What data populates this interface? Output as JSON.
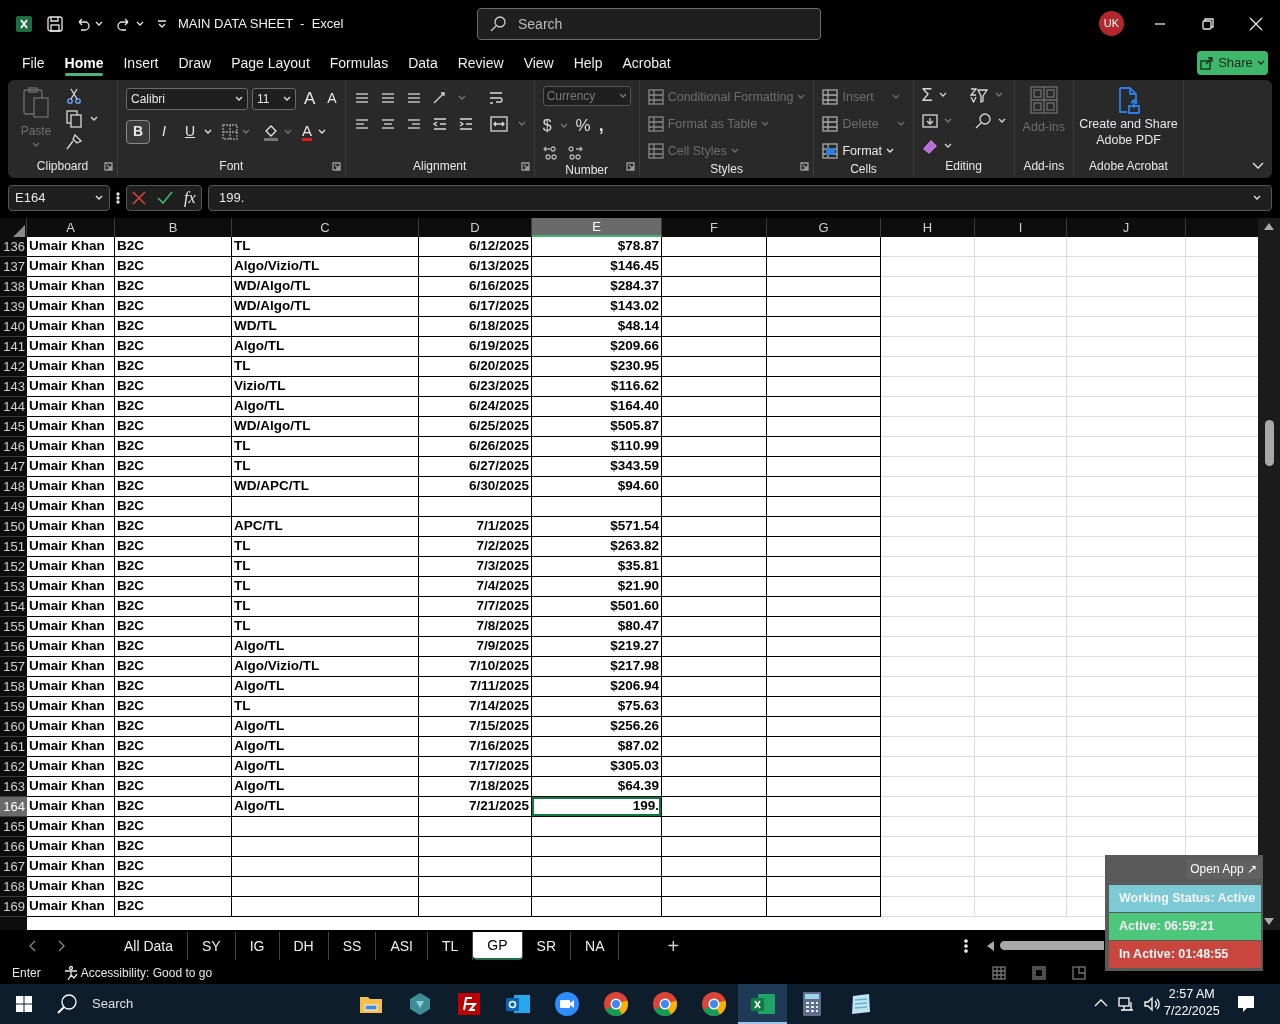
{
  "window": {
    "title": "MAIN DATA SHEET  -  Excel",
    "search_placeholder": "Search",
    "avatar": "UK"
  },
  "menu": [
    {
      "label": "File",
      "selected": false
    },
    {
      "label": "Home",
      "selected": true
    },
    {
      "label": "Insert",
      "selected": false
    },
    {
      "label": "Draw",
      "selected": false
    },
    {
      "label": "Page Layout",
      "selected": false
    },
    {
      "label": "Formulas",
      "selected": false
    },
    {
      "label": "Data",
      "selected": false
    },
    {
      "label": "Review",
      "selected": false
    },
    {
      "label": "View",
      "selected": false
    },
    {
      "label": "Help",
      "selected": false
    },
    {
      "label": "Acrobat",
      "selected": false
    }
  ],
  "share_button": "Share",
  "ribbon": {
    "clipboard": {
      "label": "Clipboard",
      "paste": "Paste",
      "paste_disabled": true
    },
    "font": {
      "label": "Font",
      "family": "Calibri",
      "size": "11",
      "grow": "A",
      "shrink": "A",
      "color_button": "A",
      "styles": [
        {
          "label": "B",
          "selected": true
        },
        {
          "label": "I",
          "selected": false
        },
        {
          "label": "U",
          "selected": false
        }
      ]
    },
    "alignment": {
      "label": "Alignment"
    },
    "number": {
      "label": "Number",
      "format": "Currency",
      "currency": "$",
      "percent": "%",
      "comma": ","
    },
    "styles": {
      "label": "Styles",
      "items": [
        {
          "label": "Conditional Formatting",
          "disabled": true
        },
        {
          "label": "Format as Table",
          "disabled": true
        },
        {
          "label": "Cell Styles",
          "disabled": true
        }
      ]
    },
    "cells": {
      "label": "Cells",
      "items": [
        {
          "label": "Insert",
          "disabled": true
        },
        {
          "label": "Delete",
          "disabled": true
        },
        {
          "label": "Format",
          "disabled": false
        }
      ]
    },
    "editing": {
      "label": "Editing",
      "sum": "Σ"
    },
    "addins": {
      "label": "Add-ins",
      "button": "Add-ins",
      "disabled": true
    },
    "acrobat": {
      "label": "Adobe Acrobat",
      "button": "Create and Share Adobe PDF"
    }
  },
  "formula_bar": {
    "name_box": "E164",
    "fx": "fx",
    "value": "199."
  },
  "columns": [
    {
      "label": "A",
      "selected": false
    },
    {
      "label": "B",
      "selected": false
    },
    {
      "label": "C",
      "selected": false
    },
    {
      "label": "D",
      "selected": false
    },
    {
      "label": "E",
      "selected": true
    },
    {
      "label": "F",
      "selected": false
    },
    {
      "label": "G",
      "selected": false
    },
    {
      "label": "H",
      "selected": false
    },
    {
      "label": "I",
      "selected": false
    },
    {
      "label": "J",
      "selected": false
    }
  ],
  "rows": [
    {
      "row": "136",
      "selected": false,
      "a": "Umair Khan",
      "b": "B2C",
      "c": "TL",
      "d": "6/12/2025",
      "e": "$78.87"
    },
    {
      "row": "137",
      "selected": false,
      "a": "Umair Khan",
      "b": "B2C",
      "c": "Algo/Vizio/TL",
      "d": "6/13/2025",
      "e": "$146.45"
    },
    {
      "row": "138",
      "selected": false,
      "a": "Umair Khan",
      "b": "B2C",
      "c": "WD/Algo/TL",
      "d": "6/16/2025",
      "e": "$284.37"
    },
    {
      "row": "139",
      "selected": false,
      "a": "Umair Khan",
      "b": "B2C",
      "c": "WD/Algo/TL",
      "d": "6/17/2025",
      "e": "$143.02"
    },
    {
      "row": "140",
      "selected": false,
      "a": "Umair Khan",
      "b": "B2C",
      "c": "WD/TL",
      "d": "6/18/2025",
      "e": "$48.14"
    },
    {
      "row": "141",
      "selected": false,
      "a": "Umair Khan",
      "b": "B2C",
      "c": "Algo/TL",
      "d": "6/19/2025",
      "e": "$209.66"
    },
    {
      "row": "142",
      "selected": false,
      "a": "Umair Khan",
      "b": "B2C",
      "c": "TL",
      "d": "6/20/2025",
      "e": "$230.95"
    },
    {
      "row": "143",
      "selected": false,
      "a": "Umair Khan",
      "b": "B2C",
      "c": "Vizio/TL",
      "d": "6/23/2025",
      "e": "$116.62"
    },
    {
      "row": "144",
      "selected": false,
      "a": "Umair Khan",
      "b": "B2C",
      "c": "Algo/TL",
      "d": "6/24/2025",
      "e": "$164.40"
    },
    {
      "row": "145",
      "selected": false,
      "a": "Umair Khan",
      "b": "B2C",
      "c": "WD/Algo/TL",
      "d": "6/25/2025",
      "e": "$505.87"
    },
    {
      "row": "146",
      "selected": false,
      "a": "Umair Khan",
      "b": "B2C",
      "c": "TL",
      "d": "6/26/2025",
      "e": "$110.99"
    },
    {
      "row": "147",
      "selected": false,
      "a": "Umair Khan",
      "b": "B2C",
      "c": "TL",
      "d": "6/27/2025",
      "e": "$343.59"
    },
    {
      "row": "148",
      "selected": false,
      "a": "Umair Khan",
      "b": "B2C",
      "c": "WD/APC/TL",
      "d": "6/30/2025",
      "e": "$94.60"
    },
    {
      "row": "149",
      "selected": false,
      "a": "Umair Khan",
      "b": "B2C"
    },
    {
      "row": "150",
      "selected": false,
      "a": "Umair Khan",
      "b": "B2C",
      "c": "APC/TL",
      "d": "7/1/2025",
      "e": "$571.54"
    },
    {
      "row": "151",
      "selected": false,
      "a": "Umair Khan",
      "b": "B2C",
      "c": "TL",
      "d": "7/2/2025",
      "e": "$263.82"
    },
    {
      "row": "152",
      "selected": false,
      "a": "Umair Khan",
      "b": "B2C",
      "c": "TL",
      "d": "7/3/2025",
      "e": "$35.81"
    },
    {
      "row": "153",
      "selected": false,
      "a": "Umair Khan",
      "b": "B2C",
      "c": "TL",
      "d": "7/4/2025",
      "e": "$21.90"
    },
    {
      "row": "154",
      "selected": false,
      "a": "Umair Khan",
      "b": "B2C",
      "c": "TL",
      "d": "7/7/2025",
      "e": "$501.60"
    },
    {
      "row": "155",
      "selected": false,
      "a": "Umair Khan",
      "b": "B2C",
      "c": "TL",
      "d": "7/8/2025",
      "e": "$80.47"
    },
    {
      "row": "156",
      "selected": false,
      "a": "Umair Khan",
      "b": "B2C",
      "c": "Algo/TL",
      "d": "7/9/2025",
      "e": "$219.27"
    },
    {
      "row": "157",
      "selected": false,
      "a": "Umair Khan",
      "b": "B2C",
      "c": "Algo/Vizio/TL",
      "d": "7/10/2025",
      "e": "$217.98"
    },
    {
      "row": "158",
      "selected": false,
      "a": "Umair Khan",
      "b": "B2C",
      "c": "Algo/TL",
      "d": "7/11/2025",
      "e": "$206.94"
    },
    {
      "row": "159",
      "selected": false,
      "a": "Umair Khan",
      "b": "B2C",
      "c": "TL",
      "d": "7/14/2025",
      "e": "$75.63"
    },
    {
      "row": "160",
      "selected": false,
      "a": "Umair Khan",
      "b": "B2C",
      "c": "Algo/TL",
      "d": "7/15/2025",
      "e": "$256.26"
    },
    {
      "row": "161",
      "selected": false,
      "a": "Umair Khan",
      "b": "B2C",
      "c": "Algo/TL",
      "d": "7/16/2025",
      "e": "$87.02"
    },
    {
      "row": "162",
      "selected": false,
      "a": "Umair Khan",
      "b": "B2C",
      "c": "Algo/TL",
      "d": "7/17/2025",
      "e": "$305.03"
    },
    {
      "row": "163",
      "selected": false,
      "a": "Umair Khan",
      "b": "B2C",
      "c": "Algo/TL",
      "d": "7/18/2025",
      "e": "$64.39"
    },
    {
      "row": "164",
      "selected": true,
      "a": "Umair Khan",
      "b": "B2C",
      "c": "Algo/TL",
      "d": "7/21/2025",
      "e": "199."
    },
    {
      "row": "165",
      "selected": false,
      "a": "Umair Khan",
      "b": "B2C"
    },
    {
      "row": "166",
      "selected": false,
      "a": "Umair Khan",
      "b": "B2C"
    },
    {
      "row": "167",
      "selected": false,
      "a": "Umair Khan",
      "b": "B2C"
    },
    {
      "row": "168",
      "selected": false,
      "a": "Umair Khan",
      "b": "B2C"
    },
    {
      "row": "169",
      "selected": false,
      "a": "Umair Khan",
      "b": "B2C"
    }
  ],
  "sheet_tabs": [
    {
      "label": "All Data",
      "selected": false
    },
    {
      "label": "SY",
      "selected": false
    },
    {
      "label": "IG",
      "selected": false
    },
    {
      "label": "DH",
      "selected": false
    },
    {
      "label": "SS",
      "selected": false
    },
    {
      "label": "ASI",
      "selected": false
    },
    {
      "label": "TL",
      "selected": false
    },
    {
      "label": "GP",
      "selected": true
    },
    {
      "label": "SR",
      "selected": false
    },
    {
      "label": "NA",
      "selected": false
    }
  ],
  "add_sheet": "+",
  "status_bar": {
    "mode": "Enter",
    "accessibility": "Accessibility: Good to go"
  },
  "tracker": {
    "open_app": "Open App ↗",
    "items": [
      {
        "label": "Working Status: Active",
        "color": "#7ccad6"
      },
      {
        "label": "Active: 06:59:21",
        "color": "#4cc77c"
      },
      {
        "label": "In Active: 01:48:55",
        "color": "#c9463f"
      }
    ]
  },
  "taskbar": {
    "search": "Search",
    "apps": [
      {
        "kind": "folder",
        "active": false
      },
      {
        "kind": "gem",
        "active": false
      },
      {
        "kind": "filezilla",
        "active": false
      },
      {
        "kind": "outlook",
        "active": false
      },
      {
        "kind": "zoom",
        "active": false
      },
      {
        "kind": "chrome",
        "active": false
      },
      {
        "kind": "chrome",
        "active": false
      },
      {
        "kind": "chrome",
        "active": false
      },
      {
        "kind": "excel",
        "active": true
      },
      {
        "kind": "calculator",
        "active": false
      },
      {
        "kind": "notepad",
        "active": false
      }
    ],
    "time": "2:57 AM",
    "date": "7/22/2025"
  }
}
